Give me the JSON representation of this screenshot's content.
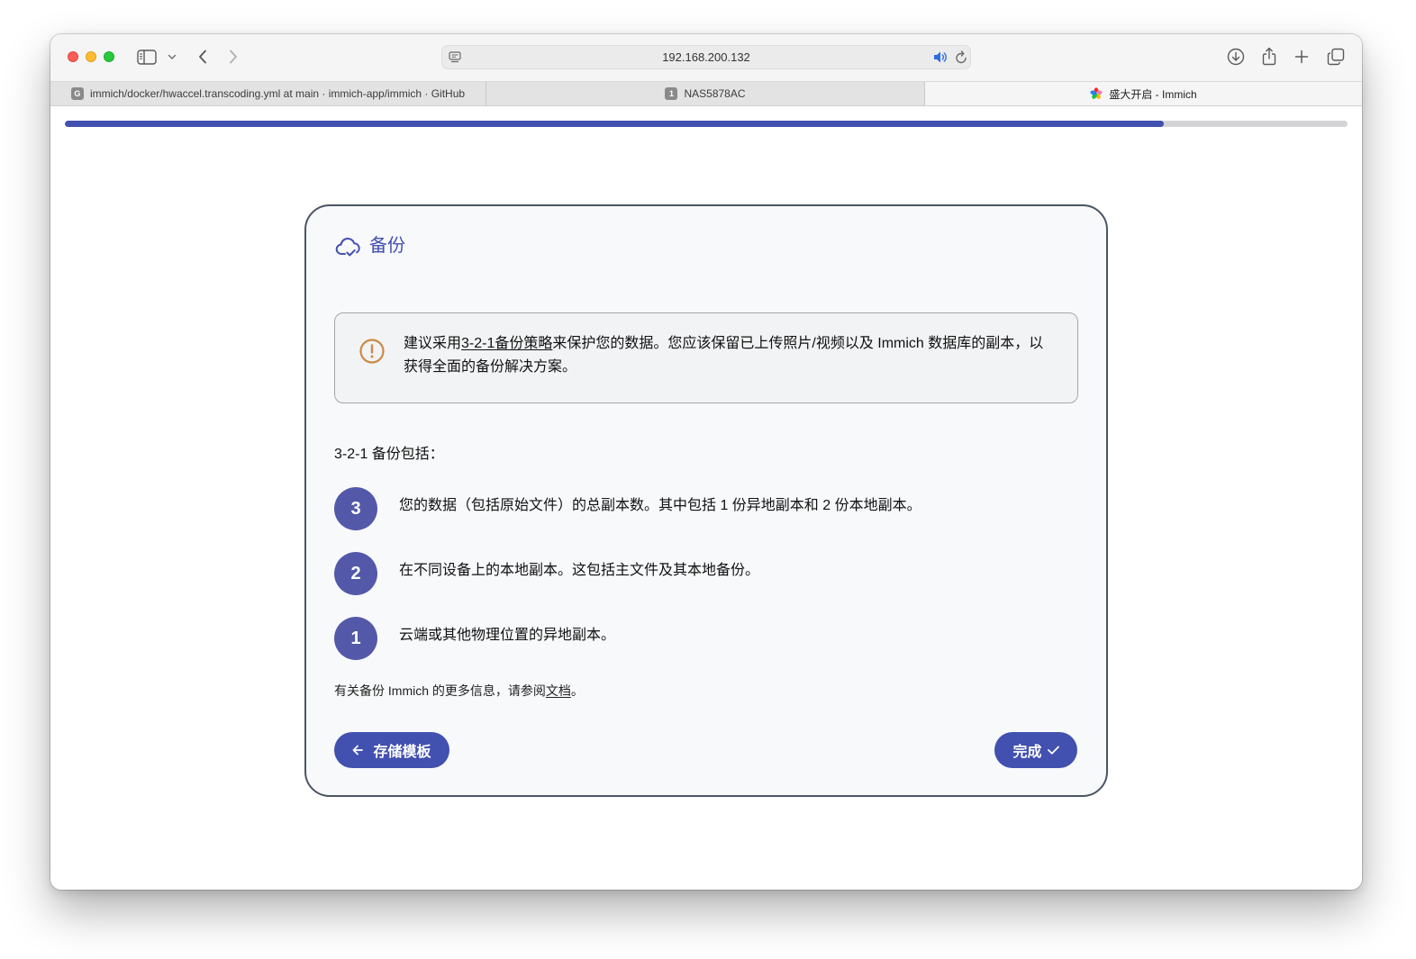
{
  "browser": {
    "url": "192.168.200.132",
    "tabs": [
      {
        "title": "immich/docker/hwaccel.transcoding.yml at main · immich-app/immich · GitHub",
        "favicon_letter": "G",
        "active": false
      },
      {
        "title": "NAS5878AC",
        "favicon_letter": "1",
        "active": false
      },
      {
        "title": "盛大开启 - Immich",
        "favicon_icon": "immich-logo-icon",
        "active": true
      }
    ],
    "toolbar_icons": [
      "sidebar-icon",
      "chevron-down-icon",
      "chevron-left-icon",
      "chevron-right-icon",
      "page-menu-icon",
      "audio-speaker-icon",
      "reload-icon",
      "download-icon",
      "share-icon",
      "plus-icon",
      "tab-overview-icon"
    ]
  },
  "onboarding": {
    "progress": 0.857,
    "title_icon": "cloud-check-icon",
    "title": "备份",
    "alert": {
      "icon": "alert-circle-outline-icon",
      "text_before": "建议采用",
      "link_text": "3-2-1备份策略",
      "text_after": "来保护您的数据。您应该保留已上传照片/视频以及 Immich 数据库的副本，以获得全面的备份解决方案。"
    },
    "rules_heading": "3-2-1 备份包括：",
    "rules": [
      {
        "number": "3",
        "text": "您的数据（包括原始文件）的总副本数。其中包括 1 份异地副本和 2 份本地副本。"
      },
      {
        "number": "2",
        "text": "在不同设备上的本地副本。这包括主文件及其本地备份。"
      },
      {
        "number": "1",
        "text": "云端或其他物理位置的异地副本。"
      }
    ],
    "docs_hint": {
      "text_before": "有关备份 Immich 的更多信息，请参阅",
      "link_text": "文档",
      "text_after": "。"
    },
    "back_button": {
      "icon": "arrow-left-icon",
      "label": "存储模板"
    },
    "done_button": {
      "label": "完成",
      "icon": "check-icon"
    }
  },
  "colors": {
    "accent": "#4250af",
    "rule_badge": "#5358a8",
    "warning": "#c98a45",
    "audio_indicator": "#2f6de1"
  }
}
